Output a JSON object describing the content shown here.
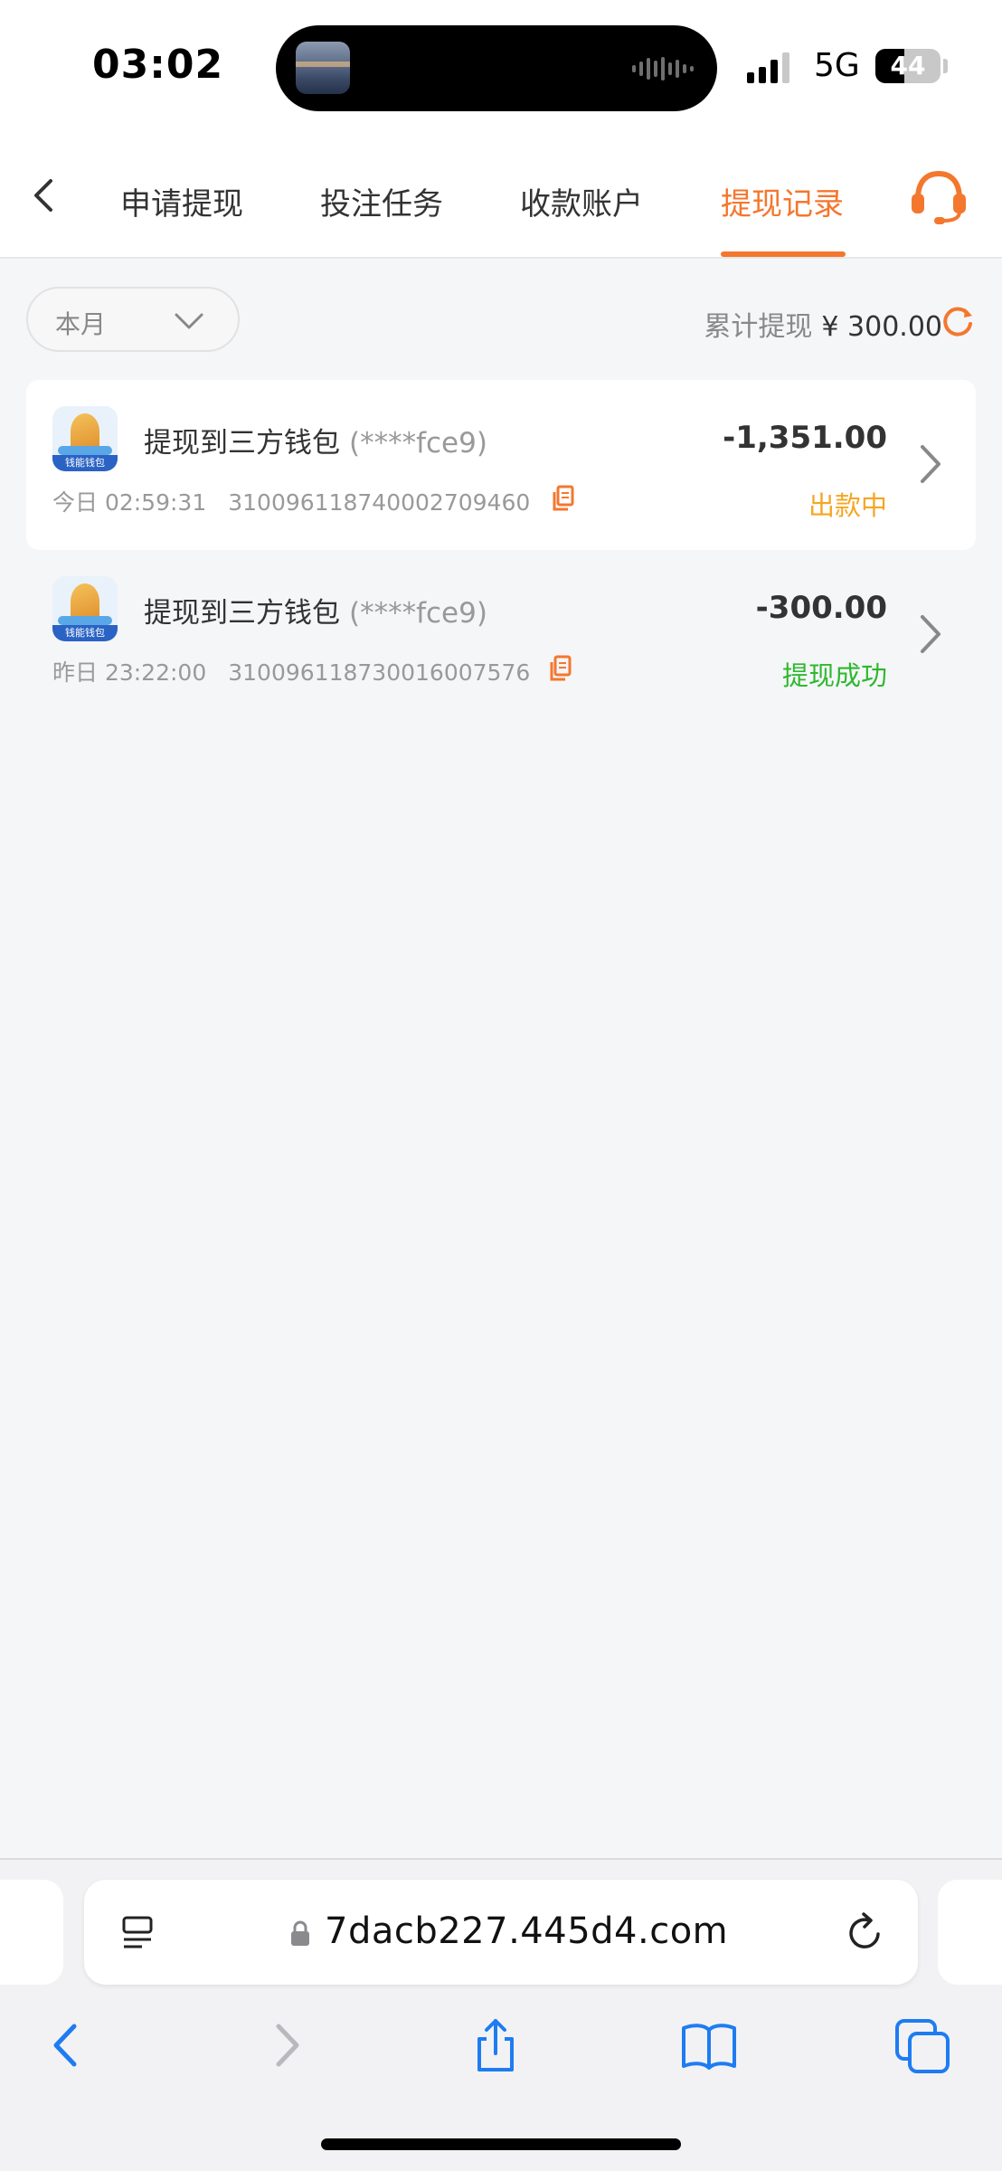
{
  "status_bar": {
    "time": "03:02",
    "network": "5G",
    "battery": "44",
    "battery_level": 0.44
  },
  "nav": {
    "tabs": [
      {
        "label": "申请提现"
      },
      {
        "label": "投注任务"
      },
      {
        "label": "收款账户"
      },
      {
        "label": "提现记录",
        "active": true
      }
    ],
    "back_icon": "chevron-left-icon",
    "support_icon": "headset-icon"
  },
  "filter": {
    "selected": "本月"
  },
  "summary": {
    "label": "累计提现",
    "amount": "¥ 300.00"
  },
  "records": [
    {
      "logo_text": "钱能钱包",
      "title": "提现到三方钱包",
      "account": "(****fce9)",
      "time": "今日 02:59:31",
      "order_no": "31009611874000270946​0",
      "amount": "-1,351.00",
      "status": "出款中",
      "status_color": "#f5a623"
    },
    {
      "logo_text": "钱能钱包",
      "title": "提现到三方钱包",
      "account": "(****fce9)",
      "time": "昨日 23:22:00",
      "order_no": "310096118730016007576",
      "amount": "-300.00",
      "status": "提现成功",
      "status_color": "#2eb82e"
    }
  ],
  "browser": {
    "url": "7dacb227.445d4.com",
    "toolbar": [
      "back-icon",
      "forward-icon",
      "share-icon",
      "bookmarks-icon",
      "tabs-icon"
    ]
  },
  "colors": {
    "accent": "#f4772e",
    "pending": "#f5a623",
    "success": "#2eb82e",
    "browser_blue": "#1e7cf2"
  }
}
